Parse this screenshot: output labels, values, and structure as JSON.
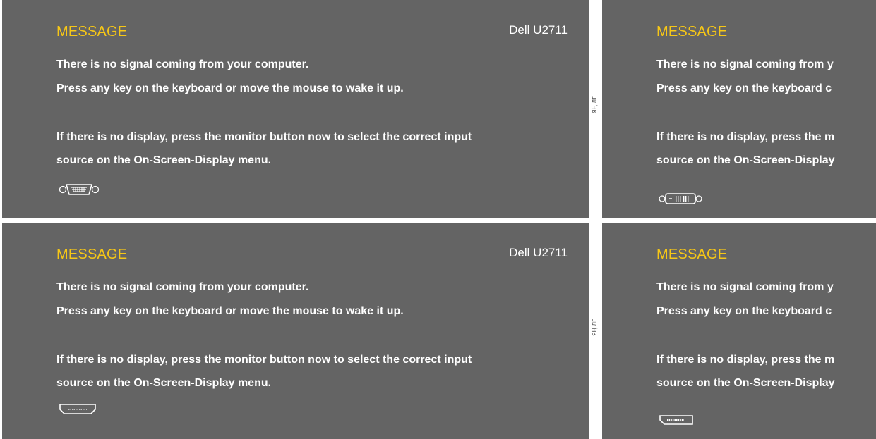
{
  "side_label": "ЯҢ ЛГ",
  "panels": [
    {
      "id": "top-left",
      "title": "MESSAGE",
      "model": "Dell U2711",
      "line1": "There is no signal coming from your computer.",
      "line2": "Press any key on the keyboard or move the mouse to wake it up.",
      "line3": "If there is no display, press the monitor button now to select the correct input",
      "line4": "source on the On-Screen-Display menu.",
      "connector_icon": "vga-connector-icon"
    },
    {
      "id": "top-right",
      "title": "MESSAGE",
      "line1": "There is no signal coming from y",
      "line2": "Press any key on the keyboard c",
      "line3": "If there is no display, press the m",
      "line4": "source on the On-Screen-Display",
      "connector_icon": "dvi-connector-icon"
    },
    {
      "id": "bottom-left",
      "title": "MESSAGE",
      "model": "Dell U2711",
      "line1": "There is no signal coming from your computer.",
      "line2": "Press any key on the keyboard or move the mouse to wake it up.",
      "line3": "If there is no display, press the monitor button now to select the correct input",
      "line4": "source on the On-Screen-Display menu.",
      "connector_icon": "hdmi-connector-icon"
    },
    {
      "id": "bottom-right",
      "title": "MESSAGE",
      "line1": "There is no signal coming from y",
      "line2": "Press any key on the keyboard c",
      "line3": "If there is no display, press the m",
      "line4": "source on the On-Screen-Display",
      "connector_icon": "displayport-connector-icon"
    }
  ],
  "colors": {
    "panel_background": "#646464",
    "title_color": "#f7c716",
    "text_color": "#ffffff"
  }
}
